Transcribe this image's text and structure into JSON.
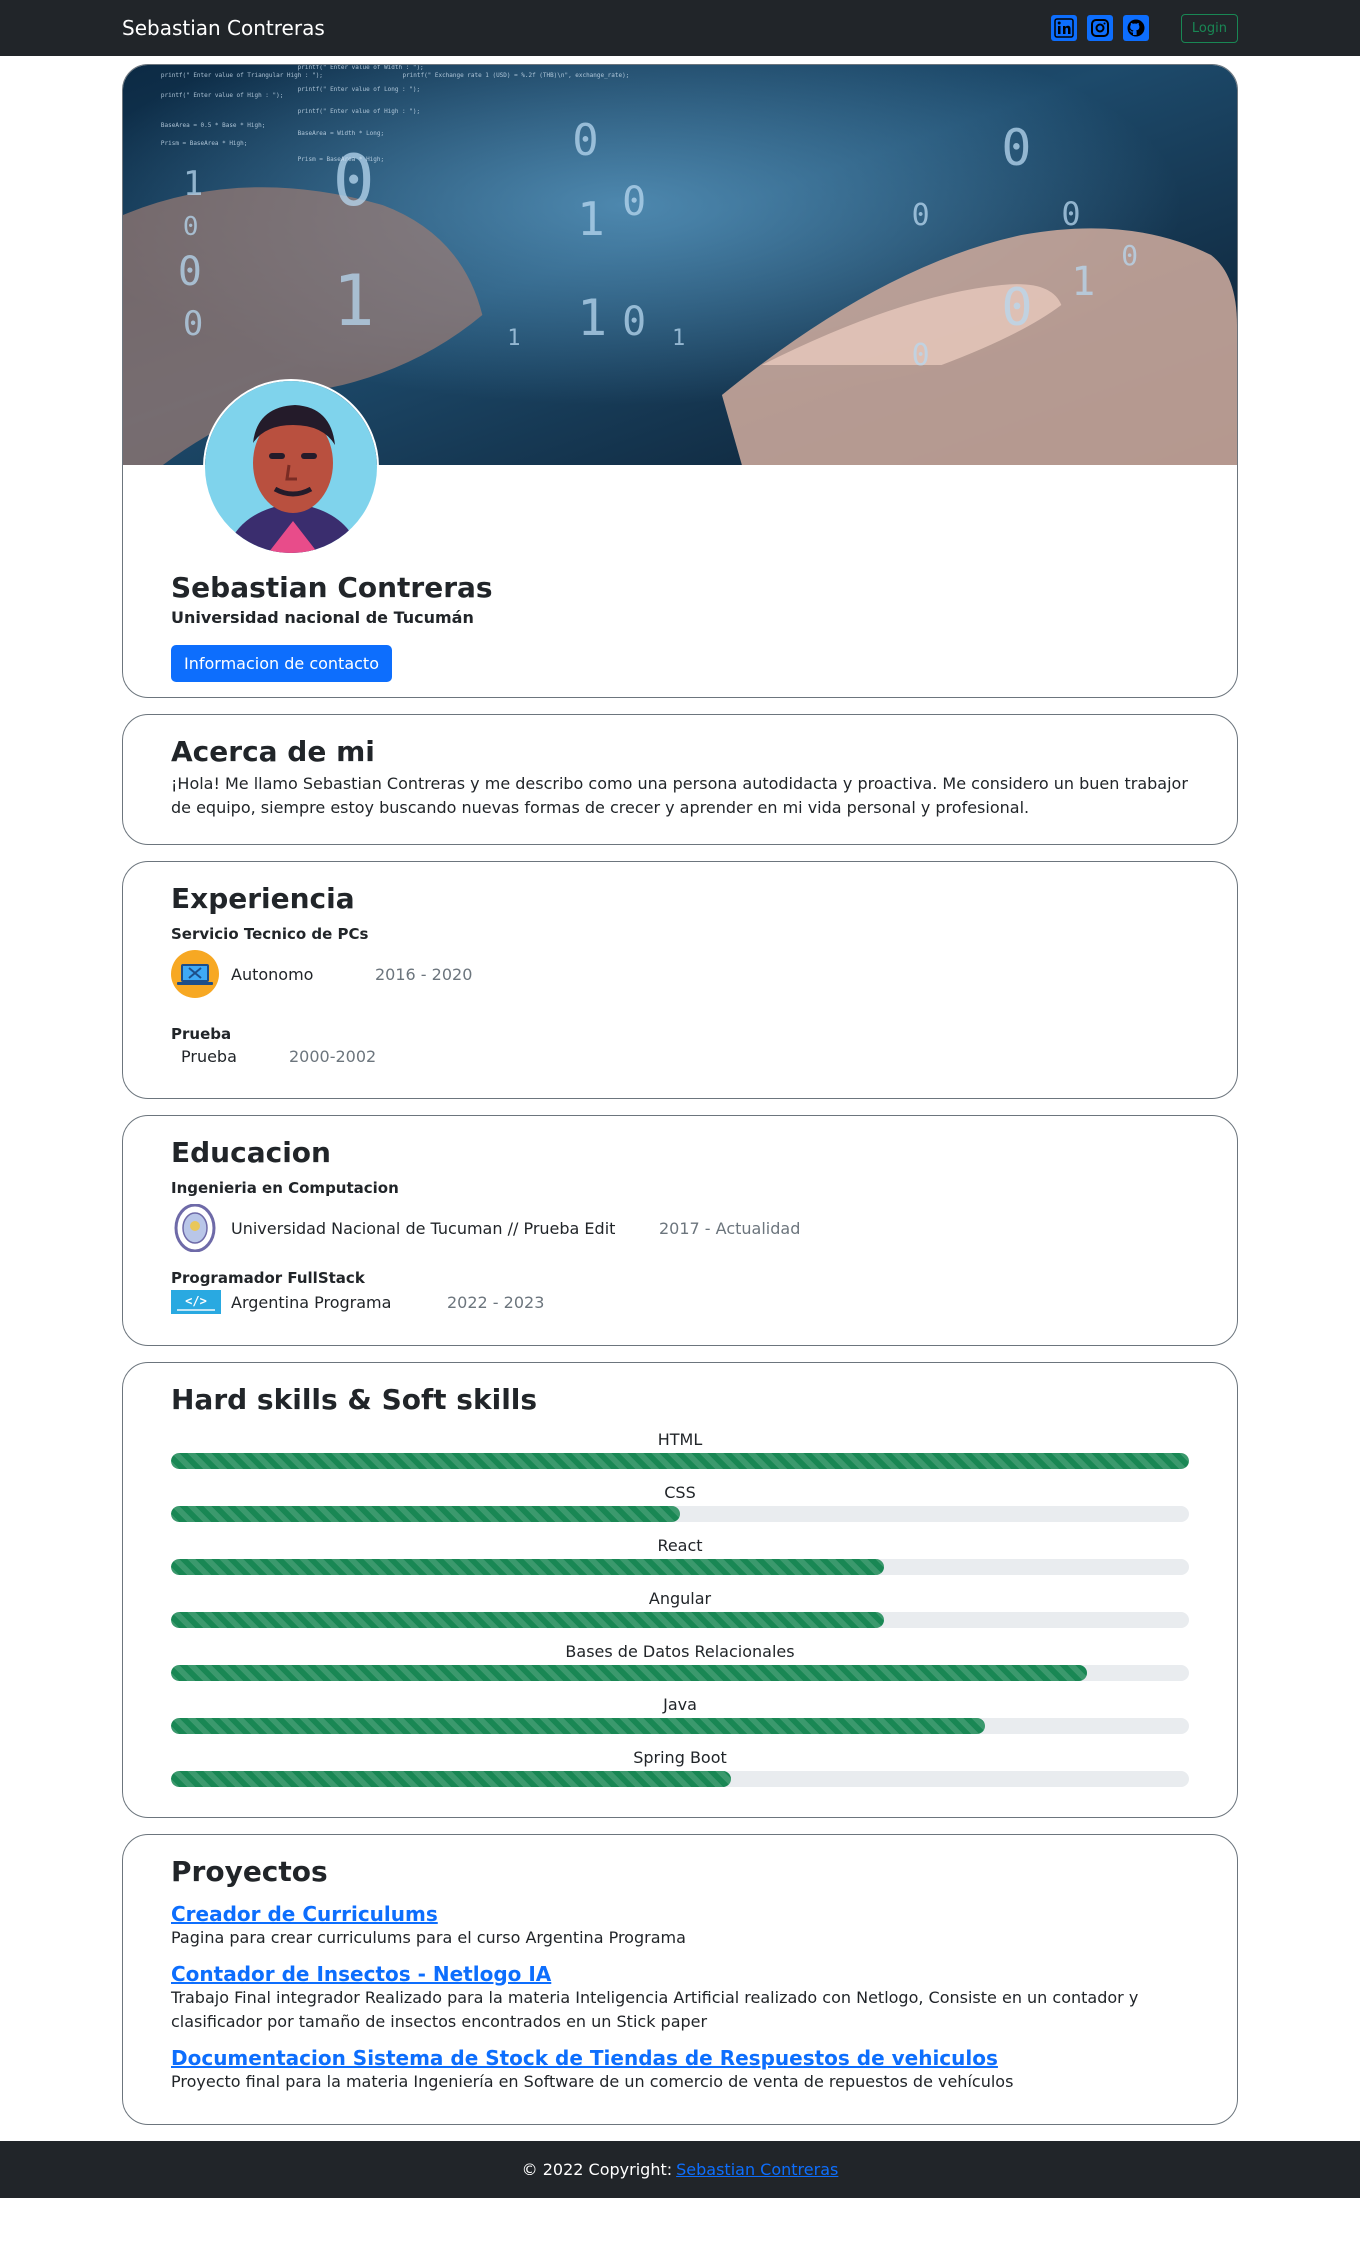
{
  "navbar": {
    "brand": "Sebastian Contreras",
    "social": [
      "linkedin-icon",
      "instagram-icon",
      "github-icon"
    ],
    "login_label": "Login"
  },
  "profile": {
    "name": "Sebastian Contreras",
    "university": "Universidad nacional de Tucumán",
    "contact_button": "Informacion de contacto"
  },
  "about": {
    "title": "Acerca de mi",
    "text": "¡Hola! Me llamo Sebastian Contreras y me describo como una persona autodidacta y proactiva. Me considero un buen trabajor de equipo, siempre estoy buscando nuevas formas de crecer y aprender en mi vida personal y profesional."
  },
  "experience": {
    "title": "Experiencia",
    "items": [
      {
        "title": "Servicio Tecnico de PCs",
        "place": "Autonomo",
        "years": "2016 - 2020",
        "logo": "pc-repair-icon"
      },
      {
        "title": "Prueba",
        "place": "Prueba",
        "years": "2000-2002",
        "logo": ""
      }
    ]
  },
  "education": {
    "title": "Educacion",
    "items": [
      {
        "title": "Ingenieria en Computacion",
        "place": "Universidad Nacional de Tucuman // Prueba Edit",
        "years": "2017 - Actualidad",
        "logo": "university-seal-icon"
      },
      {
        "title": "Programador FullStack",
        "place": "Argentina Programa",
        "years": "2022 - 2023",
        "logo": "argentina-programa-logo"
      }
    ]
  },
  "skills": {
    "title": "Hard skills & Soft skills",
    "items": [
      {
        "name": "HTML",
        "percent": 100
      },
      {
        "name": "CSS",
        "percent": 50
      },
      {
        "name": "React",
        "percent": 70
      },
      {
        "name": "Angular",
        "percent": 70
      },
      {
        "name": "Bases de Datos Relacionales",
        "percent": 90
      },
      {
        "name": "Java",
        "percent": 80
      },
      {
        "name": "Spring Boot",
        "percent": 55
      }
    ]
  },
  "projects": {
    "title": "Proyectos",
    "items": [
      {
        "name": "Creador de Curriculums",
        "description": "Pagina para crear curriculums para el curso Argentina Programa"
      },
      {
        "name": "Contador de Insectos - Netlogo IA",
        "description": "Trabajo Final integrador Realizado para la materia Inteligencia Artificial realizado con Netlogo, Consiste en un contador y clasificador por tamaño de insectos encontrados en un Stick paper"
      },
      {
        "name": "Documentacion Sistema de Stock de Tiendas de Respuestos de vehiculos",
        "description": "Proyecto final para la materia Ingeniería en Software de un comercio de venta de repuestos de vehículos"
      }
    ]
  },
  "footer": {
    "text": "© 2022 Copyright:",
    "link": "Sebastian Contreras"
  }
}
